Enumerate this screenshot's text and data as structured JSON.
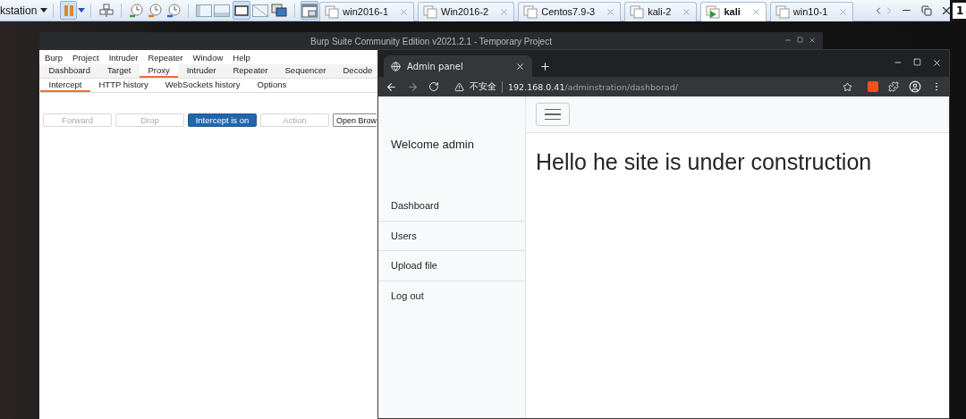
{
  "vm_toolbar": {
    "menu_label": "kstation",
    "badge": "1",
    "tabs": [
      {
        "label": "win2016-1",
        "selected": false,
        "running": false
      },
      {
        "label": "Win2016-2",
        "selected": false,
        "running": false
      },
      {
        "label": "Centos7.9-3",
        "selected": false,
        "running": false
      },
      {
        "label": "kali-2",
        "selected": false,
        "running": false
      },
      {
        "label": "kali",
        "selected": true,
        "running": true
      },
      {
        "label": "win10-1",
        "selected": false,
        "running": false
      }
    ]
  },
  "burp": {
    "title": "Burp Suite Community Edition v2021.2.1 - Temporary Project",
    "menu": [
      "Burp",
      "Project",
      "Intruder",
      "Repeater",
      "Window",
      "Help"
    ],
    "tabs": [
      {
        "label": "Dashboard",
        "selected": false
      },
      {
        "label": "Target",
        "selected": false
      },
      {
        "label": "Proxy",
        "selected": true
      },
      {
        "label": "Intruder",
        "selected": false
      },
      {
        "label": "Repeater",
        "selected": false
      },
      {
        "label": "Sequencer",
        "selected": false
      },
      {
        "label": "Decode",
        "selected": false
      }
    ],
    "subtabs": [
      {
        "label": "Intercept",
        "selected": true
      },
      {
        "label": "HTTP history",
        "selected": false
      },
      {
        "label": "WebSockets history",
        "selected": false
      },
      {
        "label": "Options",
        "selected": false
      }
    ],
    "buttons": [
      {
        "label": "Forward",
        "kind": "plain",
        "disabled": true
      },
      {
        "label": "Drop",
        "kind": "plain",
        "disabled": true
      },
      {
        "label": "Intercept is on",
        "kind": "primary",
        "disabled": false
      },
      {
        "label": "Action",
        "kind": "plain",
        "disabled": true
      },
      {
        "label": "Open Brow",
        "kind": "plain",
        "disabled": false
      }
    ]
  },
  "browser": {
    "tab_title": "Admin panel",
    "security_label": "不安全",
    "url_host": "192.168.0.41",
    "url_path": "/adminstration/dashborad/",
    "sidebar": {
      "brand": "Welcome admin",
      "items": [
        "Dashboard",
        "Users",
        "Upload file",
        "Log out"
      ]
    },
    "heading": "Hello he site is under construction"
  }
}
